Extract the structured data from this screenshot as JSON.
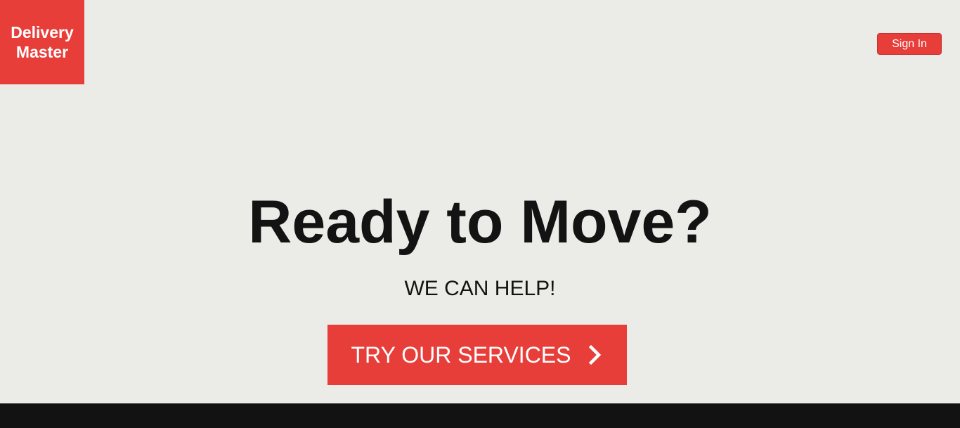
{
  "brand": {
    "line1": "Delivery",
    "line2": "Master",
    "color": "#e83e3a"
  },
  "header": {
    "signin_label": "Sign In"
  },
  "hero": {
    "title": "Ready to Move?",
    "subtitle": "WE CAN HELP!",
    "cta_label": "TRY OUR SERVICES",
    "cta_icon": "chevron-right-icon"
  },
  "colors": {
    "accent": "#e83e3a",
    "background": "#ebebe7",
    "text": "#131313",
    "footer": "#121212"
  }
}
